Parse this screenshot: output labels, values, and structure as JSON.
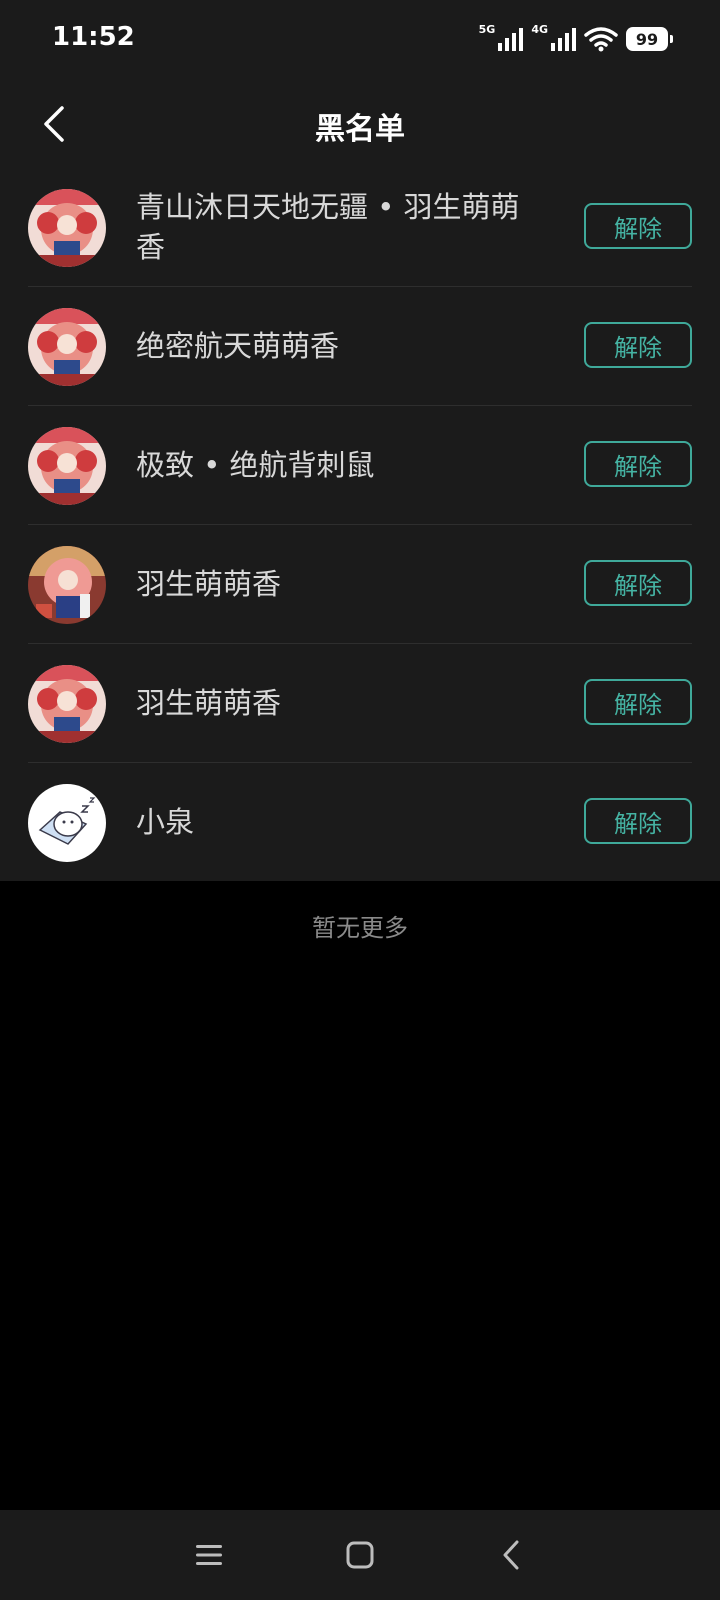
{
  "status_bar": {
    "time": "11:52",
    "network_1": "5G",
    "network_2": "4G",
    "battery": "99"
  },
  "header": {
    "title": "黑名单"
  },
  "blocked_users": [
    {
      "name": "青山沐日天地无疆 • 羽生萌萌香",
      "action": "解除",
      "avatar": "pink-hair-avatar"
    },
    {
      "name": "绝密航天萌萌香",
      "action": "解除",
      "avatar": "pink-hair-avatar"
    },
    {
      "name": "极致 • 绝航背刺鼠",
      "action": "解除",
      "avatar": "pink-hair-avatar"
    },
    {
      "name": "羽生萌萌香",
      "action": "解除",
      "avatar": "pink-hair-avatar-alt"
    },
    {
      "name": "羽生萌萌香",
      "action": "解除",
      "avatar": "pink-hair-avatar"
    },
    {
      "name": "小泉",
      "action": "解除",
      "avatar": "sleeping-cat-avatar"
    }
  ],
  "footer": {
    "no_more": "暂无更多"
  },
  "colors": {
    "background": "#000000",
    "surface": "#1b1b1b",
    "accent": "#45b3a3",
    "text": "#d8d8d8"
  }
}
